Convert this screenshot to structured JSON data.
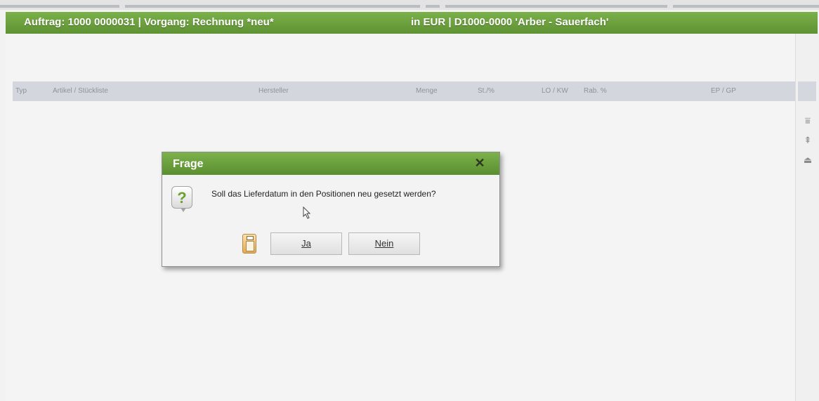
{
  "header": {
    "order": "Auftrag: 1000 0000031 | Vorgang: Rechnung *neu*",
    "currency_customer": "in EUR |  D1000-0000 'Arber - Sauerfach'"
  },
  "columns": [
    "Typ",
    "Artikel / Stückliste",
    "Hersteller",
    "Menge",
    "St./%",
    "LO / KW",
    "Rab. %",
    "EP / GP"
  ],
  "dialog": {
    "title": "Frage",
    "message": "Soll das Lieferdatum in den Positionen neu gesetzt werden?",
    "yes_label": "Ja",
    "no_label": "Nein",
    "close_icon": "close-icon",
    "question_icon": "question-icon"
  },
  "toolbar_icons": [
    "collapse-all-icon",
    "move-top-icon",
    "eject-icon"
  ],
  "colors": {
    "accent_green": "#6a9e3c",
    "header_gray": "#d3d7dd",
    "background": "#f2f2f2"
  }
}
